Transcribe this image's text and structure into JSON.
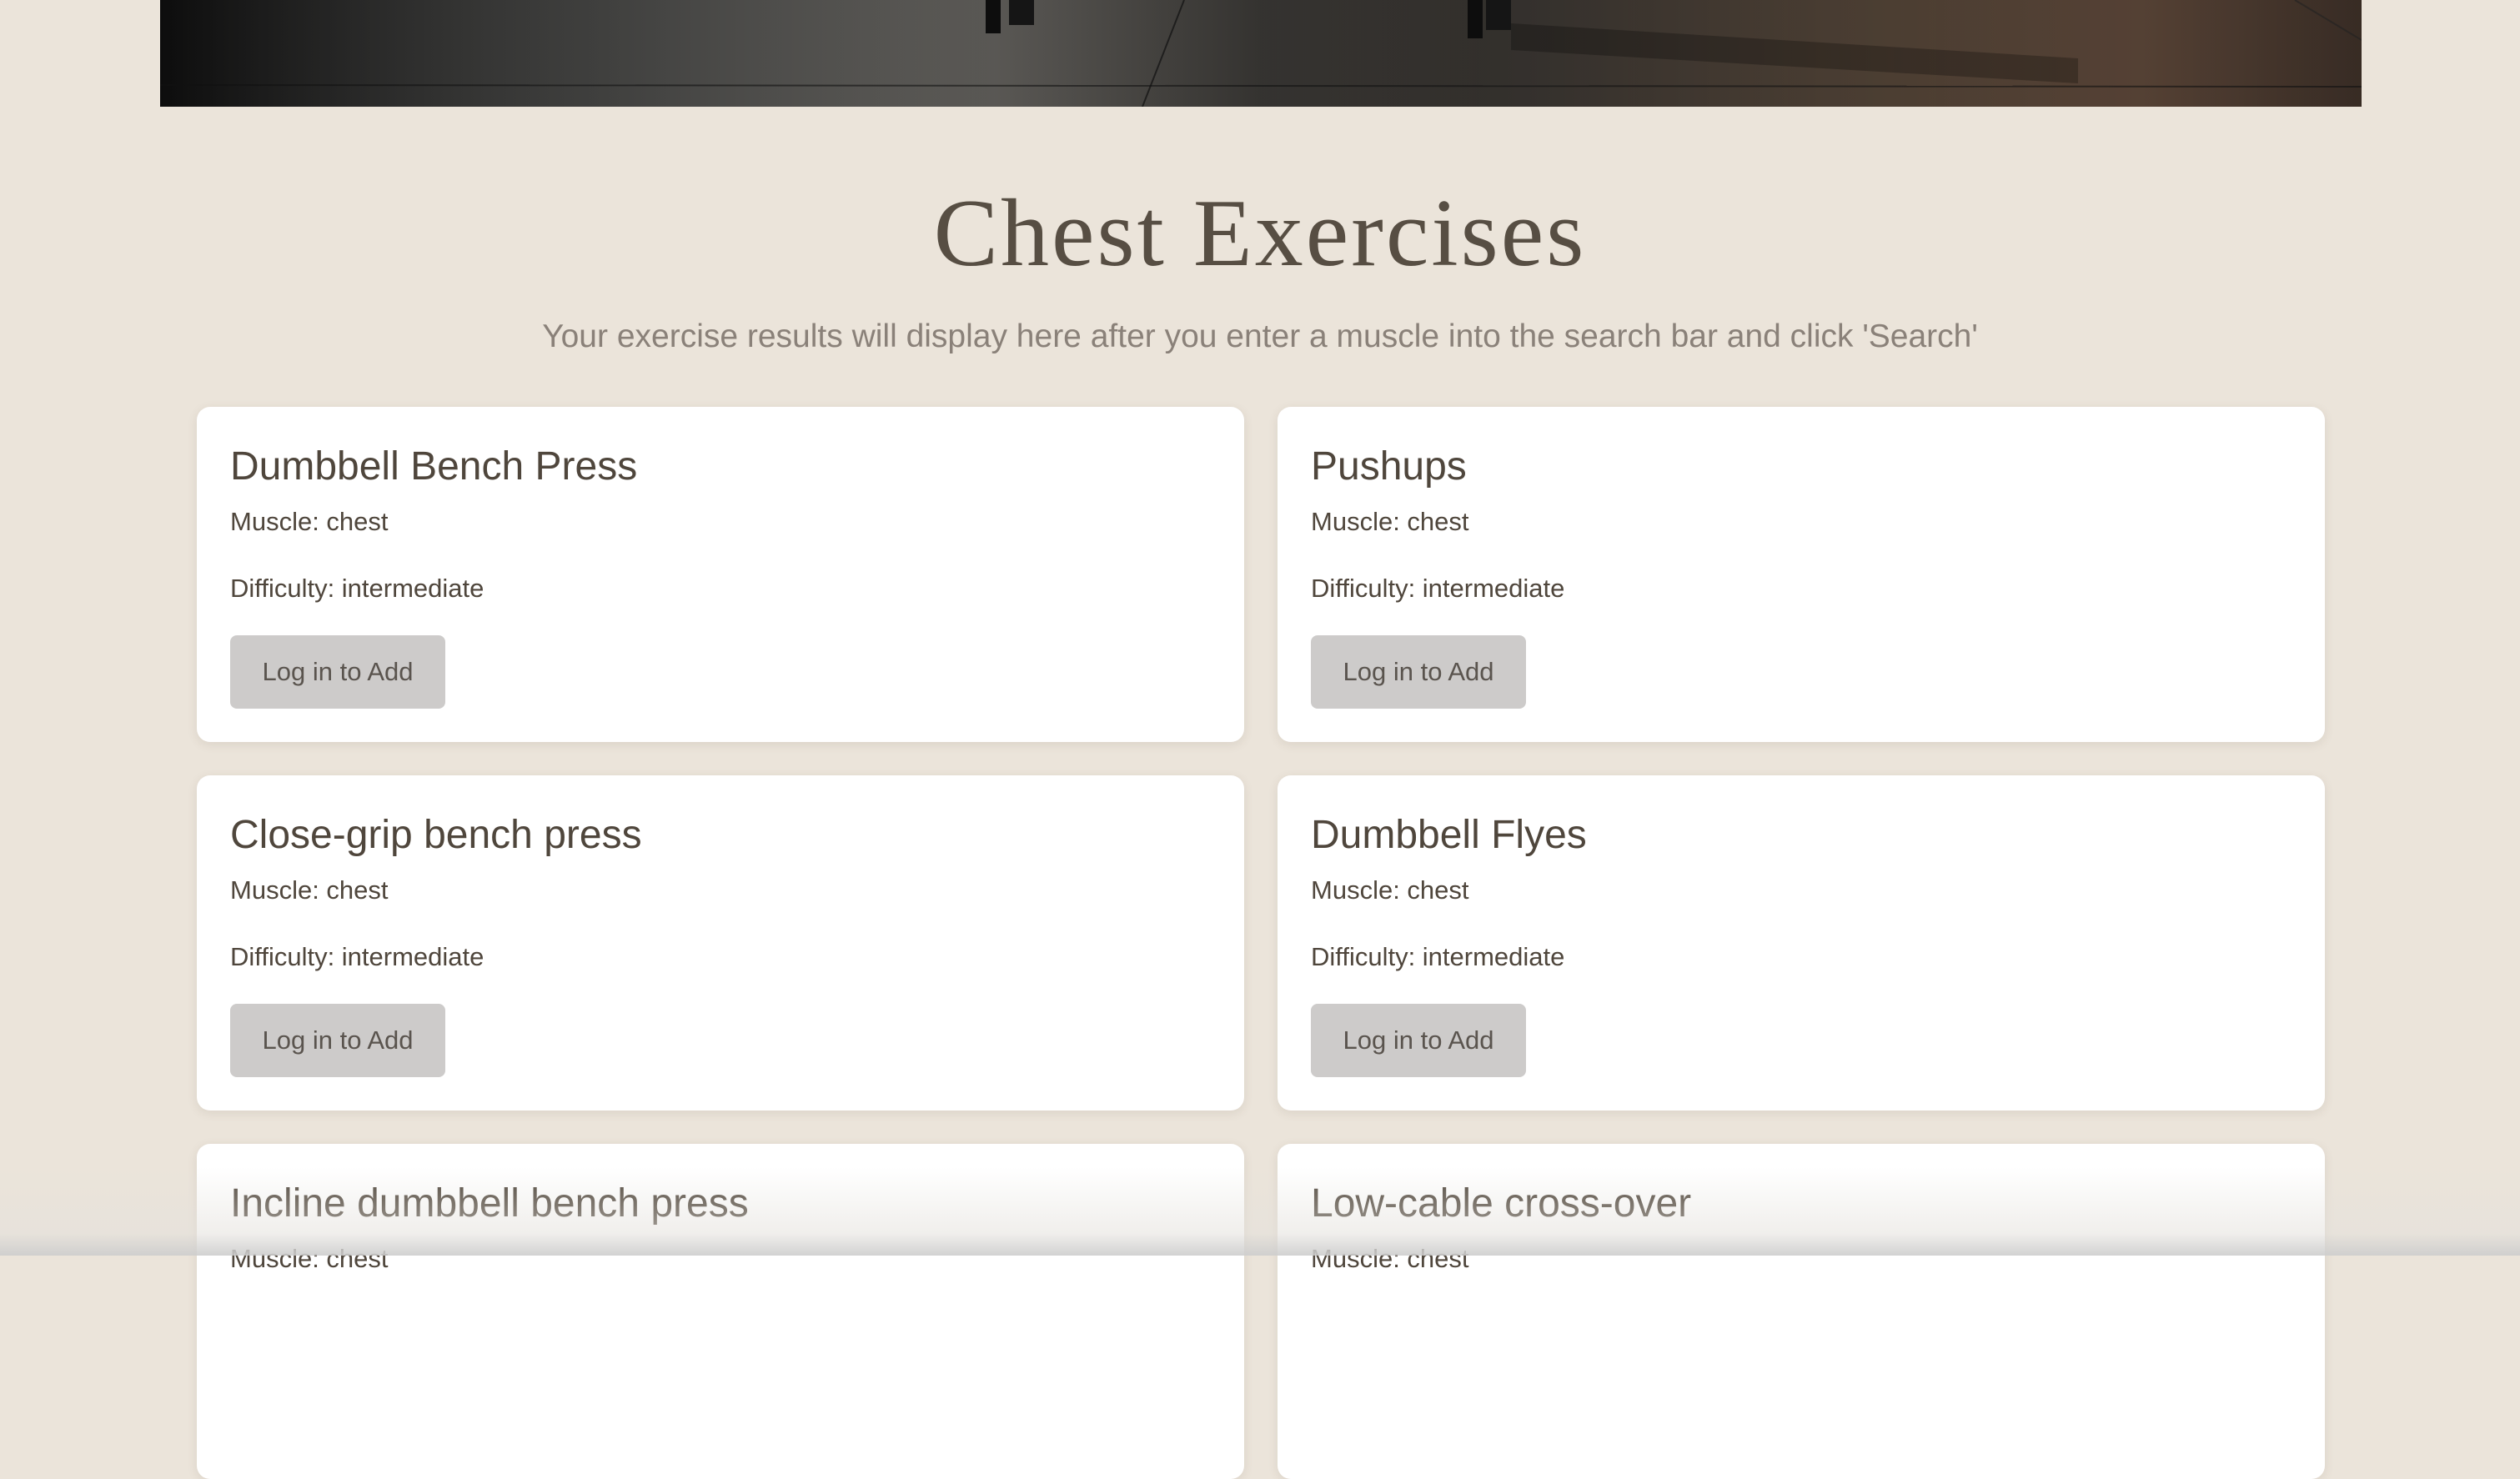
{
  "hero": {
    "image_name": "gym-floor-image"
  },
  "page": {
    "title": "Chest Exercises",
    "subtitle": "Your exercise results will display here after you enter a muscle into the search bar and click 'Search'"
  },
  "colors": {
    "background": "#ebe4da",
    "card": "#ffffff",
    "title": "#574e43",
    "subtitle": "#8a8179",
    "button": "#cdcbca",
    "button_text": "#5a544e"
  },
  "exercises": [
    {
      "name": "Dumbbell Bench Press",
      "muscle": "Muscle: chest",
      "difficulty": "Difficulty: intermediate",
      "button": "Log in to Add"
    },
    {
      "name": "Pushups",
      "muscle": "Muscle: chest",
      "difficulty": "Difficulty: intermediate",
      "button": "Log in to Add"
    },
    {
      "name": "Close-grip bench press",
      "muscle": "Muscle: chest",
      "difficulty": "Difficulty: intermediate",
      "button": "Log in to Add"
    },
    {
      "name": "Dumbbell Flyes",
      "muscle": "Muscle: chest",
      "difficulty": "Difficulty: intermediate",
      "button": "Log in to Add"
    },
    {
      "name": "Incline dumbbell bench press",
      "muscle": "Muscle: chest",
      "difficulty": "",
      "button": ""
    },
    {
      "name": "Low-cable cross-over",
      "muscle": "Muscle: chest",
      "difficulty": "",
      "button": ""
    }
  ]
}
